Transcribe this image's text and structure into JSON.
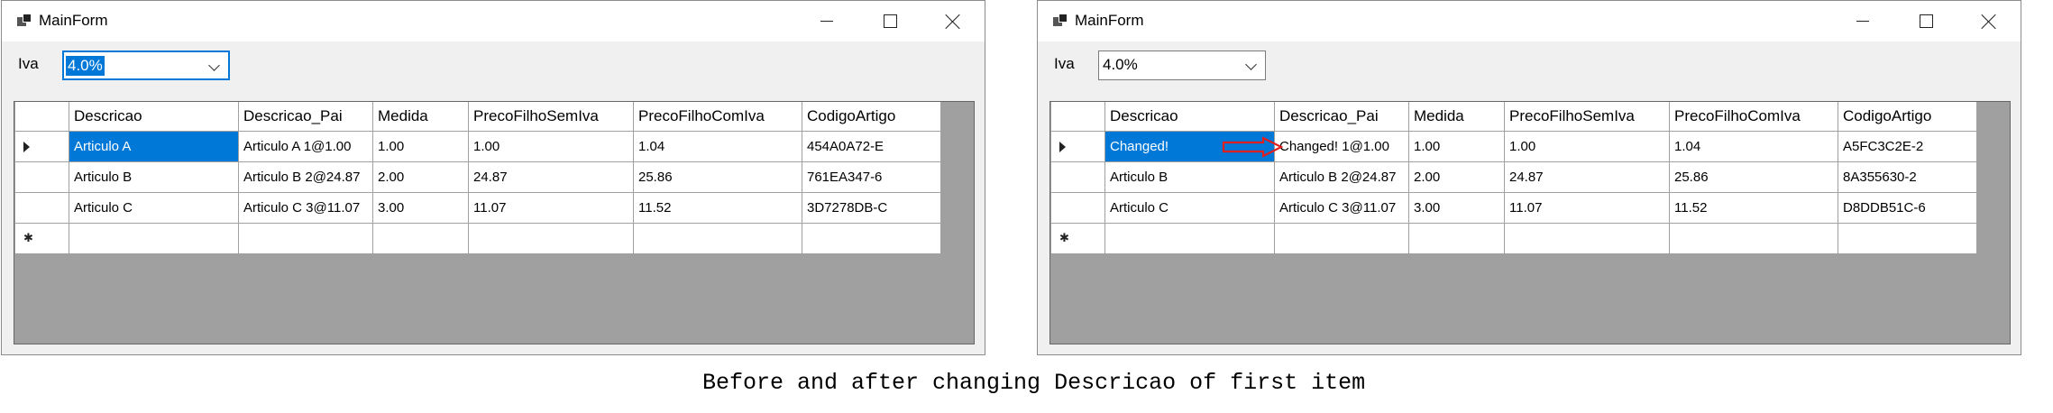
{
  "before": {
    "window_title": "MainForm",
    "iva_label": "Iva",
    "iva_value": "4.0%",
    "columns": [
      "Descricao",
      "Descricao_Pai",
      "Medida",
      "PrecoFilhoSemIva",
      "PrecoFilhoComIva",
      "CodigoArtigo"
    ],
    "rows": [
      [
        "Articulo A",
        "Articulo A 1@1.00",
        "1.00",
        "1.00",
        "1.04",
        "454A0A72-E"
      ],
      [
        "Articulo B",
        "Articulo B 2@24.87",
        "2.00",
        "24.87",
        "25.86",
        "761EA347-6"
      ],
      [
        "Articulo C",
        "Articulo C 3@11.07",
        "3.00",
        "11.07",
        "11.52",
        "3D7278DB-C"
      ]
    ]
  },
  "after": {
    "window_title": "MainForm",
    "iva_label": "Iva",
    "iva_value": "4.0%",
    "columns": [
      "Descricao",
      "Descricao_Pai",
      "Medida",
      "PrecoFilhoSemIva",
      "PrecoFilhoComIva",
      "CodigoArtigo"
    ],
    "rows": [
      [
        "Changed!",
        "Changed! 1@1.00",
        "1.00",
        "1.00",
        "1.04",
        "A5FC3C2E-2"
      ],
      [
        "Articulo B",
        "Articulo B 2@24.87",
        "2.00",
        "24.87",
        "25.86",
        "8A355630-2"
      ],
      [
        "Articulo C",
        "Articulo C 3@11.07",
        "3.00",
        "11.07",
        "11.52",
        "D8DDB51C-6"
      ]
    ]
  },
  "caption": "Before and after changing Descricao of first item",
  "colors": {
    "selection": "#0078d7",
    "annotation_arrow": "#e02020",
    "grid_background": "#a0a0a0"
  }
}
